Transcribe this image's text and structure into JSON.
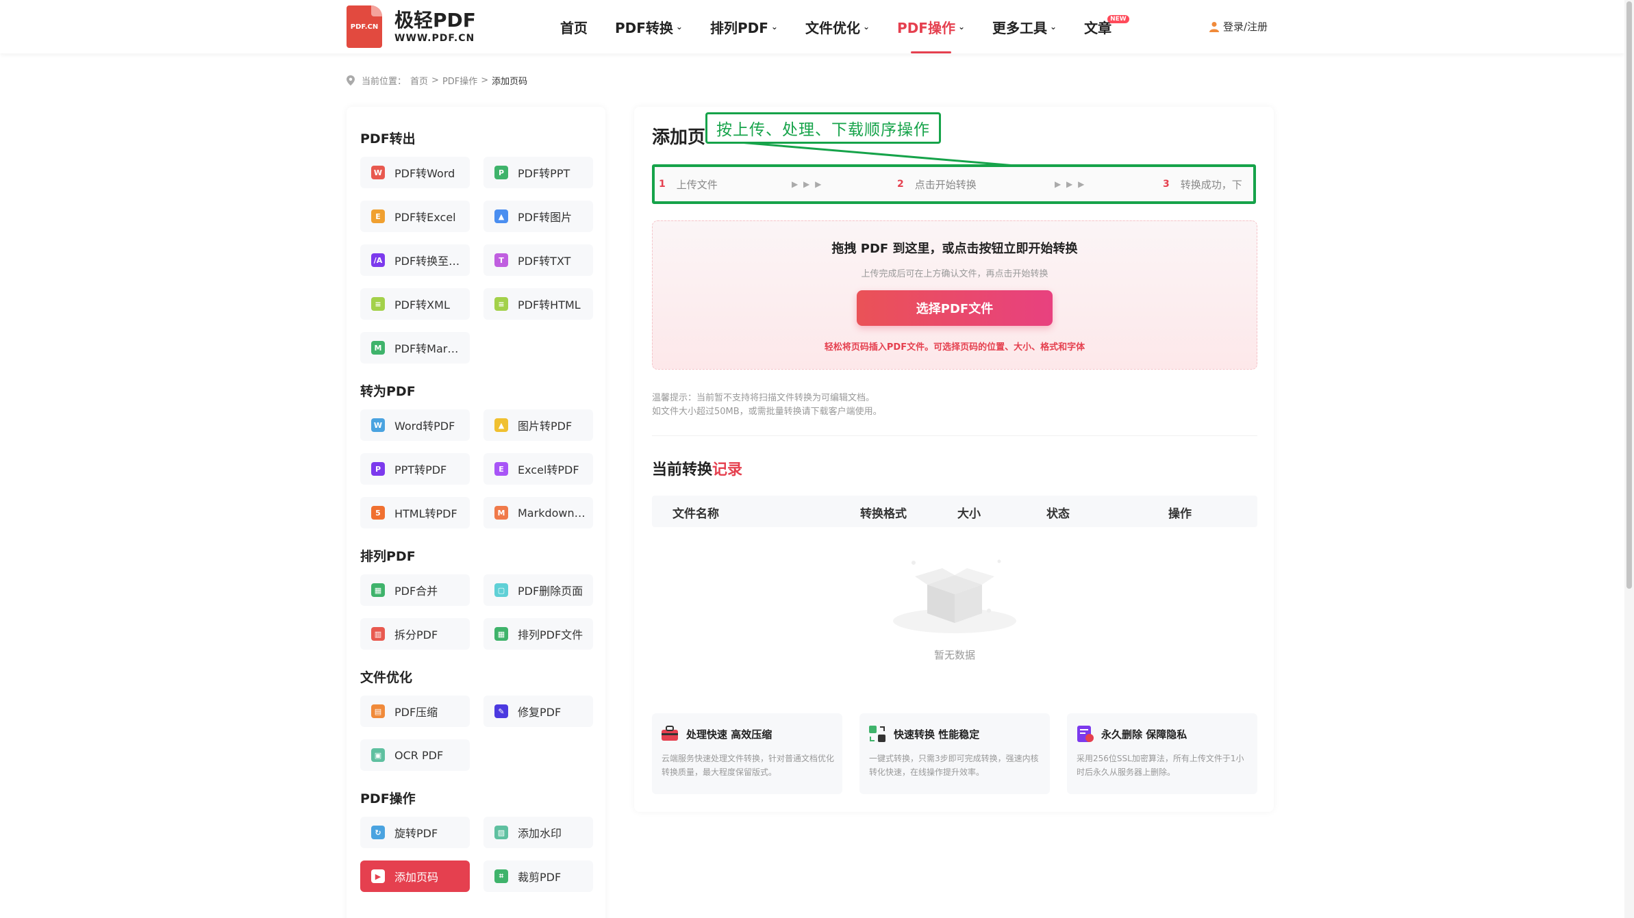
{
  "header": {
    "logo_title": "极轻PDF",
    "logo_sub": "WWW.PDF.CN",
    "logo_badge": "PDF.CN",
    "nav": [
      {
        "label": "首页",
        "chevron": false,
        "active": false
      },
      {
        "label": "PDF转换",
        "chevron": true,
        "active": false
      },
      {
        "label": "排列PDF",
        "chevron": true,
        "active": false
      },
      {
        "label": "文件优化",
        "chevron": true,
        "active": false
      },
      {
        "label": "PDF操作",
        "chevron": true,
        "active": true
      },
      {
        "label": "更多工具",
        "chevron": true,
        "active": false
      },
      {
        "label": "文章",
        "chevron": false,
        "active": false,
        "badge": "NEW"
      }
    ],
    "login": "登录/注册"
  },
  "breadcrumb": {
    "prefix": "当前位置：",
    "home": "首页",
    "parent": "PDF操作",
    "current": "添加页码",
    "sep": ">"
  },
  "sidebar": {
    "sections": [
      {
        "title": "PDF转出",
        "items": [
          {
            "label": "PDF转Word",
            "icon": "word-icon",
            "color": "#e8594f",
            "glyph": "W"
          },
          {
            "label": "PDF转PPT",
            "icon": "ppt-icon",
            "color": "#3fb36b",
            "glyph": "P"
          },
          {
            "label": "PDF转Excel",
            "icon": "excel-icon",
            "color": "#f0a030",
            "glyph": "E"
          },
          {
            "label": "PDF转图片",
            "icon": "image-icon",
            "color": "#4a8ef0",
            "glyph": "▲"
          },
          {
            "label": "PDF转换至…",
            "icon": "convert-icon",
            "color": "#7c3aed",
            "glyph": "/A"
          },
          {
            "label": "PDF转TXT",
            "icon": "txt-icon",
            "color": "#c05fe0",
            "glyph": "T"
          },
          {
            "label": "PDF转XML",
            "icon": "xml-icon",
            "color": "#a3d14a",
            "glyph": "≡"
          },
          {
            "label": "PDF转HTML",
            "icon": "html-icon",
            "color": "#a3d14a",
            "glyph": "≡"
          },
          {
            "label": "PDF转Mar…",
            "icon": "markdown-icon",
            "color": "#3fb36b",
            "glyph": "M"
          }
        ]
      },
      {
        "title": "转为PDF",
        "items": [
          {
            "label": "Word转PDF",
            "icon": "word-icon",
            "color": "#4aa3e0",
            "glyph": "W"
          },
          {
            "label": "图片转PDF",
            "icon": "image-icon",
            "color": "#f0c030",
            "glyph": "▲"
          },
          {
            "label": "PPT转PDF",
            "icon": "ppt-icon",
            "color": "#7c3aed",
            "glyph": "P"
          },
          {
            "label": "Excel转PDF",
            "icon": "excel-icon",
            "color": "#a855f7",
            "glyph": "E"
          },
          {
            "label": "HTML转PDF",
            "icon": "html-icon",
            "color": "#f07030",
            "glyph": "5"
          },
          {
            "label": "Markdown…",
            "icon": "markdown-icon",
            "color": "#f07a4a",
            "glyph": "M"
          }
        ]
      },
      {
        "title": "排列PDF",
        "items": [
          {
            "label": "PDF合并",
            "icon": "merge-icon",
            "color": "#3fb36b",
            "glyph": "▦"
          },
          {
            "label": "PDF删除页面",
            "icon": "delete-page-icon",
            "color": "#5fd0d6",
            "glyph": "▢"
          },
          {
            "label": "拆分PDF",
            "icon": "split-icon",
            "color": "#e8594f",
            "glyph": "▥"
          },
          {
            "label": "排列PDF文件",
            "icon": "arrange-icon",
            "color": "#3fb36b",
            "glyph": "▦"
          }
        ]
      },
      {
        "title": "文件优化",
        "items": [
          {
            "label": "PDF压缩",
            "icon": "compress-icon",
            "color": "#f08a3a",
            "glyph": "▤"
          },
          {
            "label": "修复PDF",
            "icon": "repair-icon",
            "color": "#4c3ae0",
            "glyph": "✎"
          },
          {
            "label": "OCR PDF",
            "icon": "ocr-icon",
            "color": "#5fc0a0",
            "glyph": "▣"
          }
        ]
      },
      {
        "title": "PDF操作",
        "items": [
          {
            "label": "旋转PDF",
            "icon": "rotate-icon",
            "color": "#4aa3e0",
            "glyph": "↻"
          },
          {
            "label": "添加水印",
            "icon": "watermark-icon",
            "color": "#5fc0a0",
            "glyph": "▨"
          },
          {
            "label": "添加页码",
            "icon": "page-number-icon",
            "color": "#ffffff",
            "glyph": "▶",
            "active": true
          },
          {
            "label": "裁剪PDF",
            "icon": "crop-icon",
            "color": "#3fb36b",
            "glyph": "⌗"
          }
        ]
      }
    ]
  },
  "main": {
    "title": "添加页",
    "annotation": "按上传、处理、下载顺序操作",
    "steps": [
      {
        "num": "1",
        "label": "上传文件"
      },
      {
        "num": "2",
        "label": "点击开始转换"
      },
      {
        "num": "3",
        "label": "转换成功，下"
      }
    ],
    "step_arrows": "▶ ▶ ▶",
    "upload": {
      "title": "拖拽 PDF 到这里，或点击按钮立即开始转换",
      "subtitle": "上传完成后可在上方确认文件，再点击开始转换",
      "button": "选择PDF文件",
      "note": "轻松将页码插入PDF文件。可选择页码的位置、大小、格式和字体"
    },
    "tips": {
      "line1": "温馨提示：当前暂不支持将扫描文件转换为可编辑文档。",
      "line2": "如文件大小超过50MB，或需批量转换请下载客户端使用。"
    },
    "records": {
      "title_a": "当前转换",
      "title_b": "记录",
      "columns": [
        "文件名称",
        "转换格式",
        "大小",
        "状态",
        "操作"
      ],
      "empty": "暂无数据"
    },
    "features": [
      {
        "title": "处理快速 高效压缩",
        "icon": "toolbox-icon",
        "desc": "云端服务快速处理文件转换，针对普通文档优化转换质量，最大程度保留版式。"
      },
      {
        "title": "快速转换 性能稳定",
        "icon": "exchange-icon",
        "desc": "一键式转换，只需3步即可完成转换，强速内核转化快速，在线操作提升效率。"
      },
      {
        "title": "永久删除 保障隐私",
        "icon": "privacy-icon",
        "desc": "采用256位SSL加密算法，所有上传文件于1小时后永久从服务器上删除。"
      }
    ]
  },
  "colors": {
    "accent": "#e5404f",
    "annotation": "#16a34a"
  }
}
